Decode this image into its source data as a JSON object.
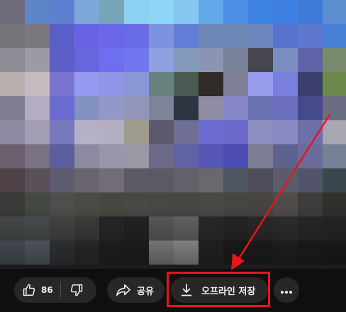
{
  "actions": {
    "like_count": "86",
    "share_label": "공유",
    "offline_save_label": "오프라인 저장"
  },
  "icons": {
    "like": "thumbs-up-icon",
    "dislike": "thumbs-down-icon",
    "share": "share-arrow-icon",
    "download": "download-icon",
    "more": "more-horizontal-icon"
  },
  "colors": {
    "background": "#0f0f0f",
    "button": "#272727",
    "text": "#f1f1f1",
    "annotation": "#e8151b"
  },
  "mosaic_colors": [
    "#6f6b78",
    "#5d86c9",
    "#5d7fd1",
    "#7ea7d9",
    "#76a5b9",
    "#8ad1f2",
    "#8fd5f7",
    "#86c7ef",
    "#63a9e9",
    "#4e8fe6",
    "#3d84e2",
    "#3e80e4",
    "#3f7ad8",
    "#5a8ecf",
    "#76737b",
    "#7b7880",
    "#595fc8",
    "#6a62e5",
    "#6d68e8",
    "#6a6ce5",
    "#7d93e0",
    "#617fd6",
    "#6e86b8",
    "#6c86b5",
    "#6d86bd",
    "#5673cd",
    "#5f78cf",
    "#4981d8",
    "#8d8b96",
    "#9d9aa3",
    "#5c5fc8",
    "#6866dc",
    "#6e6ef0",
    "#7277ef",
    "#8fa0e0",
    "#8399b9",
    "#8b95b3",
    "#7a819a",
    "#464651",
    "#7b8ec3",
    "#5f62a8",
    "#7a8a6c",
    "#b8afad",
    "#c7bbc2",
    "#7873cf",
    "#959af0",
    "#8f96e8",
    "#8a97d5",
    "#67827e",
    "#4b5a52",
    "#302a28",
    "#818099",
    "#979cec",
    "#7a7fdc",
    "#3c406d",
    "#6d8a4d",
    "#7f7c91",
    "#b4adc1",
    "#6a6ad1",
    "#8292c3",
    "#9298c7",
    "#9395b8",
    "#7e8497",
    "#2c3441",
    "#8f8da4",
    "#8886cb",
    "#6a74b5",
    "#6b6ebd",
    "#444a8b",
    "#6b6d82",
    "#8f8aa1",
    "#a29db1",
    "#7878bd",
    "#b5b0c5",
    "#b3aec0",
    "#a09c8d",
    "#5a5a6c",
    "#6f6e95",
    "#6c6bd0",
    "#6a68c8",
    "#8f8ec0",
    "#8989c3",
    "#6e6ea8",
    "#a7a6b1",
    "#6b5f6e",
    "#7a7284",
    "#5d5e9d",
    "#8d89a0",
    "#9a96aa",
    "#9b98a6",
    "#6d6a88",
    "#6161a6",
    "#5556b6",
    "#4b4bb0",
    "#7c7c94",
    "#5e628e",
    "#6b6b9c",
    "#768196",
    "#4e4147",
    "#5a5057",
    "#5e5a70",
    "#6a6470",
    "#736d79",
    "#5c5a64",
    "#5a5964",
    "#626068",
    "#6a676d",
    "#4f5763",
    "#4c4d59",
    "#5a5c6c",
    "#52546a",
    "#39484c",
    "#3a3b38",
    "#444843",
    "#4d4f4c",
    "#4a4b47",
    "#474742",
    "#484844",
    "#474743",
    "#474642",
    "#4a4946",
    "#464542",
    "#454440",
    "#4f4c49",
    "#3d3d3b",
    "#31302d",
    "#4a4e4e",
    "#4f5252",
    "#464847",
    "#3f3f3e",
    "#272928",
    "#242424",
    "#5f5f5f",
    "#6a6a6a",
    "#2b2b2b",
    "#252525",
    "#2a2a2a",
    "#2e2e2e",
    "#292929",
    "#262626",
    "#59626a",
    "#66707a",
    "#3a3c3e",
    "#303030",
    "#222222",
    "#202020",
    "#a0a0a0",
    "#b3b3b3",
    "#262626",
    "#1c1c1c",
    "#1e1e1e",
    "#222222",
    "#1d1d1d",
    "#1b1b1b"
  ]
}
